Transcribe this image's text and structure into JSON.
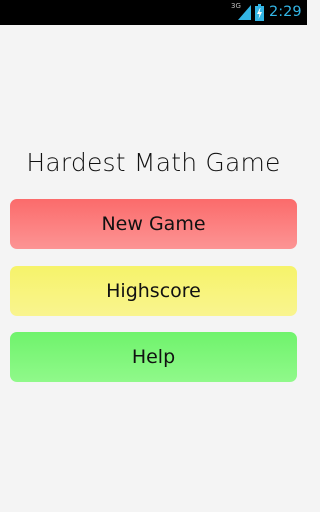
{
  "status_bar": {
    "network": "3G",
    "time": "2:29",
    "signal_color": "#33b5e5",
    "battery_color": "#33b5e5",
    "battery_icon": "battery-charging-icon",
    "signal_icon": "signal-bars-icon"
  },
  "app": {
    "title": "Hardest Math Game",
    "background_color": "#f4f4f4"
  },
  "menu": {
    "new_game": {
      "label": "New Game",
      "color_top": "#fb6b6b",
      "color_bottom": "#fc9494"
    },
    "highscore": {
      "label": "Highscore",
      "color_top": "#f6f36a",
      "color_bottom": "#f9f48f"
    },
    "help": {
      "label": "Help",
      "color_top": "#6ff36c",
      "color_bottom": "#90f98a"
    }
  }
}
